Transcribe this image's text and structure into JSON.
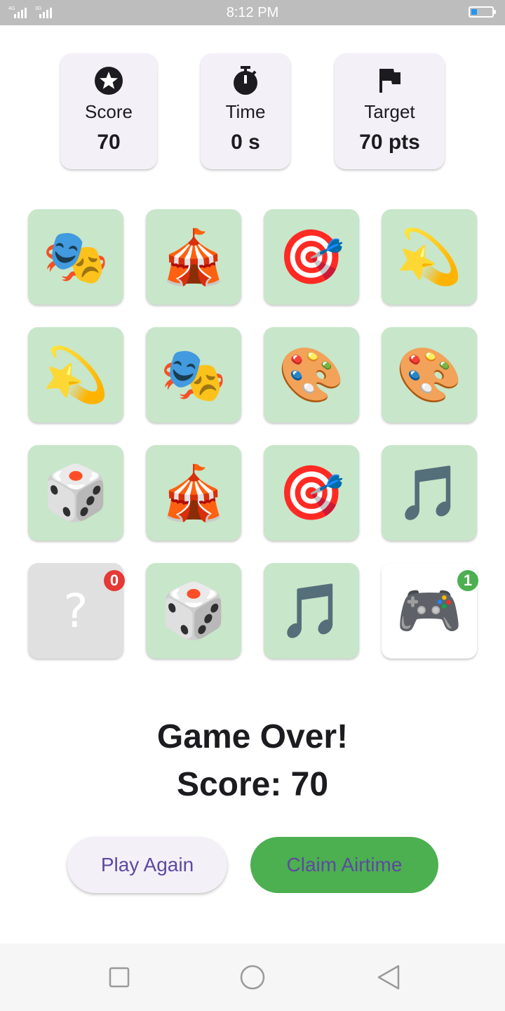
{
  "status_bar": {
    "time": "8:12 PM",
    "network_left": "4G",
    "network_right": "3G",
    "battery_level": 0.3
  },
  "stats": [
    {
      "icon": "star-circle-icon",
      "label": "Score",
      "value": "70"
    },
    {
      "icon": "timer-icon",
      "label": "Time",
      "value": "0 s"
    },
    {
      "icon": "flag-icon",
      "label": "Target",
      "value": "70 pts"
    }
  ],
  "tiles": [
    {
      "emoji": "🎭",
      "icon": "performing-arts-icon",
      "state": "matched"
    },
    {
      "emoji": "🎪",
      "icon": "circus-tent-icon",
      "state": "matched"
    },
    {
      "emoji": "🎯",
      "icon": "dart-target-icon",
      "state": "matched"
    },
    {
      "emoji": "💫",
      "icon": "sparkle-star-icon",
      "state": "matched"
    },
    {
      "emoji": "💫",
      "icon": "sparkle-star-icon",
      "state": "matched"
    },
    {
      "emoji": "🎭",
      "icon": "performing-arts-icon",
      "state": "matched"
    },
    {
      "emoji": "🎨",
      "icon": "artist-palette-icon",
      "state": "matched"
    },
    {
      "emoji": "🎨",
      "icon": "artist-palette-icon",
      "state": "matched"
    },
    {
      "emoji": "🎲",
      "icon": "game-die-icon",
      "state": "matched"
    },
    {
      "emoji": "🎪",
      "icon": "circus-tent-icon",
      "state": "matched"
    },
    {
      "emoji": "🎯",
      "icon": "dart-target-icon",
      "state": "matched"
    },
    {
      "emoji": "🎵",
      "icon": "music-note-icon",
      "state": "matched"
    },
    {
      "emoji": "?",
      "icon": "question-mark-icon",
      "state": "hidden",
      "badge": "0"
    },
    {
      "emoji": "🎲",
      "icon": "game-die-icon",
      "state": "matched"
    },
    {
      "emoji": "🎵",
      "icon": "music-note-icon",
      "state": "matched"
    },
    {
      "emoji": "🎮",
      "icon": "game-controller-icon",
      "state": "revealed",
      "badge": "1"
    }
  ],
  "game_over": {
    "title": "Game Over!",
    "score_text": "Score: 70"
  },
  "buttons": {
    "play_again": "Play Again",
    "claim_airtime": "Claim Airtime"
  },
  "colors": {
    "matched_tile": "#c8e6c9",
    "hidden_tile": "#e0e0e0",
    "card_bg": "#f4f0f8",
    "accent_green": "#4caf50",
    "badge_red": "#e53935",
    "button_text": "#5c4aa0"
  }
}
